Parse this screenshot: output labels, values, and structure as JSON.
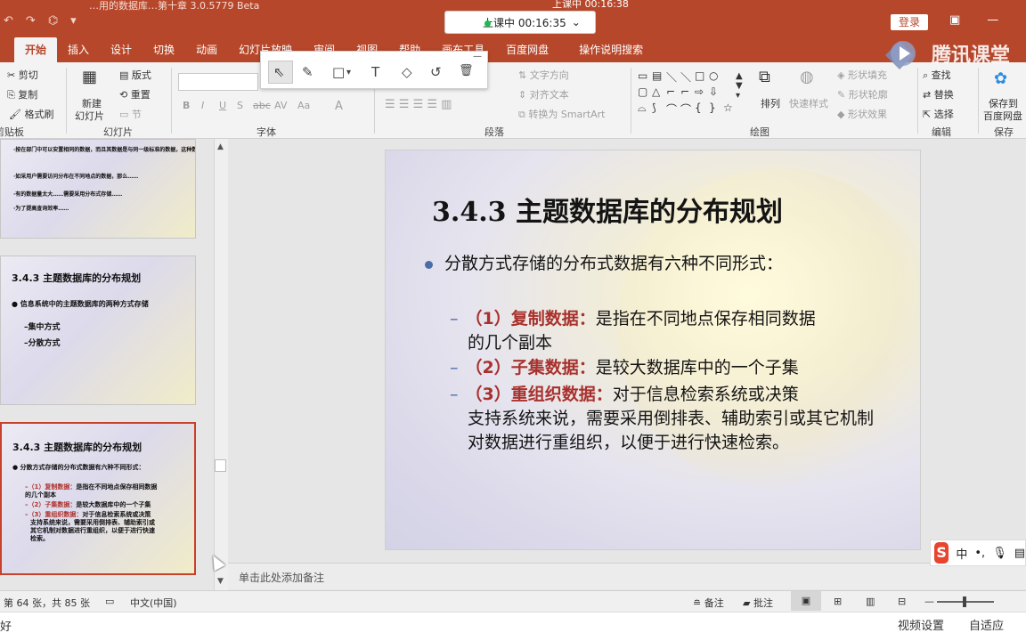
{
  "titlebar": {
    "doc_title": "…用的数据库…第十章 3.0.5779 Beta",
    "top_timer": "上课中 00:16:38",
    "live_status": "上课中 00:16:35",
    "live_chevron": "⌄",
    "login_label": "登录",
    "qat_icons": [
      "↶",
      "↷",
      "⌬",
      "▾"
    ],
    "win_icons": [
      "▣",
      "—"
    ]
  },
  "watermark": "腾讯课堂",
  "tabs": [
    {
      "label": "开始",
      "active": true
    },
    {
      "label": "插入"
    },
    {
      "label": "设计"
    },
    {
      "label": "切换"
    },
    {
      "label": "动画"
    },
    {
      "label": "幻灯片放映"
    },
    {
      "label": "审阅"
    },
    {
      "label": "视图"
    },
    {
      "label": "帮助"
    },
    {
      "label": "画布工具"
    },
    {
      "label": "百度网盘"
    },
    {
      "label": "操作说明搜索"
    }
  ],
  "ribbon": {
    "clipboard": {
      "cut": "剪切",
      "copy": "复制",
      "format_painter": "格式刷",
      "label": "剪贴板"
    },
    "slides": {
      "new_slide_1": "新建",
      "new_slide_2": "幻灯片",
      "layout": "版式",
      "reset": "重置",
      "section": "节",
      "label": "幻灯片"
    },
    "font": {
      "label": "字体",
      "bold": "B",
      "italic": "I",
      "underline": "U",
      "shadow": "S",
      "strike": "abc",
      "spacing": "AV",
      "case": "Aa",
      "color": "A"
    },
    "paragraph": {
      "label": "段落",
      "text_direction": "文字方向",
      "align_text": "对齐文本",
      "smartart": "转换为 SmartArt"
    },
    "drawing": {
      "label": "绘图",
      "arrange": "排列",
      "quick_styles": "快速样式",
      "shape_fill": "形状填充",
      "shape_outline": "形状轮廓",
      "shape_effects": "形状效果"
    },
    "editing": {
      "label": "编辑",
      "find": "查找",
      "replace": "替换",
      "select": "选择"
    },
    "save": {
      "label": "保存",
      "save_to_1": "保存到",
      "save_to_2": "百度网盘"
    }
  },
  "pen_toolbar": {
    "icons": [
      "⇖",
      "✎",
      "□",
      "T",
      "◇",
      "↺",
      "🗑"
    ],
    "caret": "▾",
    "minimize": "—"
  },
  "thumbnails": [
    {
      "lines": [
        "·按在部门中可以安置相同的数据，而且其数据是与同一级标准的数据，这种数据被重复存储在其它……",
        "·如采用户需要访问分布在不同地点的数据，那么……",
        "·有的数据量太大……需要采用分布式存储……",
        "·为了提高查询效率……"
      ]
    },
    {
      "title": "3.4.3 主题数据库的分布规划",
      "bullet": "● 信息系统中的主题数据库的两种方式存储",
      "items": [
        "–集中方式",
        "–分散方式"
      ]
    },
    {
      "title": "3.4.3 主题数据库的分布规划",
      "bullet": "● 分散方式存储的分布式数据有六种不同形式：",
      "items": [
        {
          "red": "–（1）复制数据：",
          "text": "是指在不同地点保存相同数据"
        },
        {
          "red": "",
          "text": "的几个副本"
        },
        {
          "red": "–（2）子集数据：",
          "text": "是较大数据库中的一个子集"
        },
        {
          "red": "–（3）重组织数据：",
          "text": "对于信息检索系统或决策"
        },
        {
          "red": "",
          "text": "支持系统来说，需要采用倒排表、辅助索引或"
        },
        {
          "red": "",
          "text": "其它机制对数据进行重组织，以便于进行快速"
        },
        {
          "red": "",
          "text": "检索。"
        }
      ]
    }
  ],
  "slide": {
    "title": "3.4.3 主题数据库的分布规划",
    "bullet": "分散方式存储的分布式数据有六种不同形式：",
    "subs": [
      {
        "dash": "–",
        "red": "（1）复制数据：",
        "text": "是指在不同地点保存相同数据",
        "cont": "的几个副本"
      },
      {
        "dash": "–",
        "red": "（2）子集数据：",
        "text": "是较大数据库中的一个子集",
        "cont": ""
      },
      {
        "dash": "–",
        "red": "（3）重组织数据：",
        "text": "对于信息检索系统或决策",
        "cont": "支持系统来说，需要采用倒排表、辅助索引或其它机制对数据进行重组织，以便于进行快速检索。"
      }
    ]
  },
  "notes_placeholder": "单击此处添加备注",
  "ime": {
    "logo": "S",
    "lang": "中",
    "punct": "•,",
    "mic": "🎙",
    "more": "▤"
  },
  "statusbar": {
    "slide_count": "第 64 张，共 85 张",
    "spell_icon": "▭",
    "language": "中文(中国)",
    "notes_label": "备注",
    "comments_label": "批注",
    "view_icons": [
      "▣",
      "⊞",
      "▥",
      "⊟"
    ],
    "zoom_minus": "—"
  },
  "player": {
    "left_text": "好",
    "video_settings": "视频设置",
    "auto_fit": "自适应"
  },
  "colors": {
    "accent": "#b7472a",
    "slide_red": "#a8312d",
    "slide_blue": "#4b6da8"
  }
}
